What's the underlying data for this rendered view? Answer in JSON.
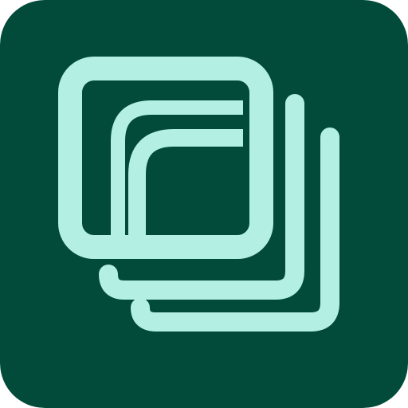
{
  "app_icon": {
    "icon_name": "stacked-layers-logo-icon",
    "colors": {
      "background": "#024B3B",
      "foreground": "#B3F0E3"
    }
  }
}
